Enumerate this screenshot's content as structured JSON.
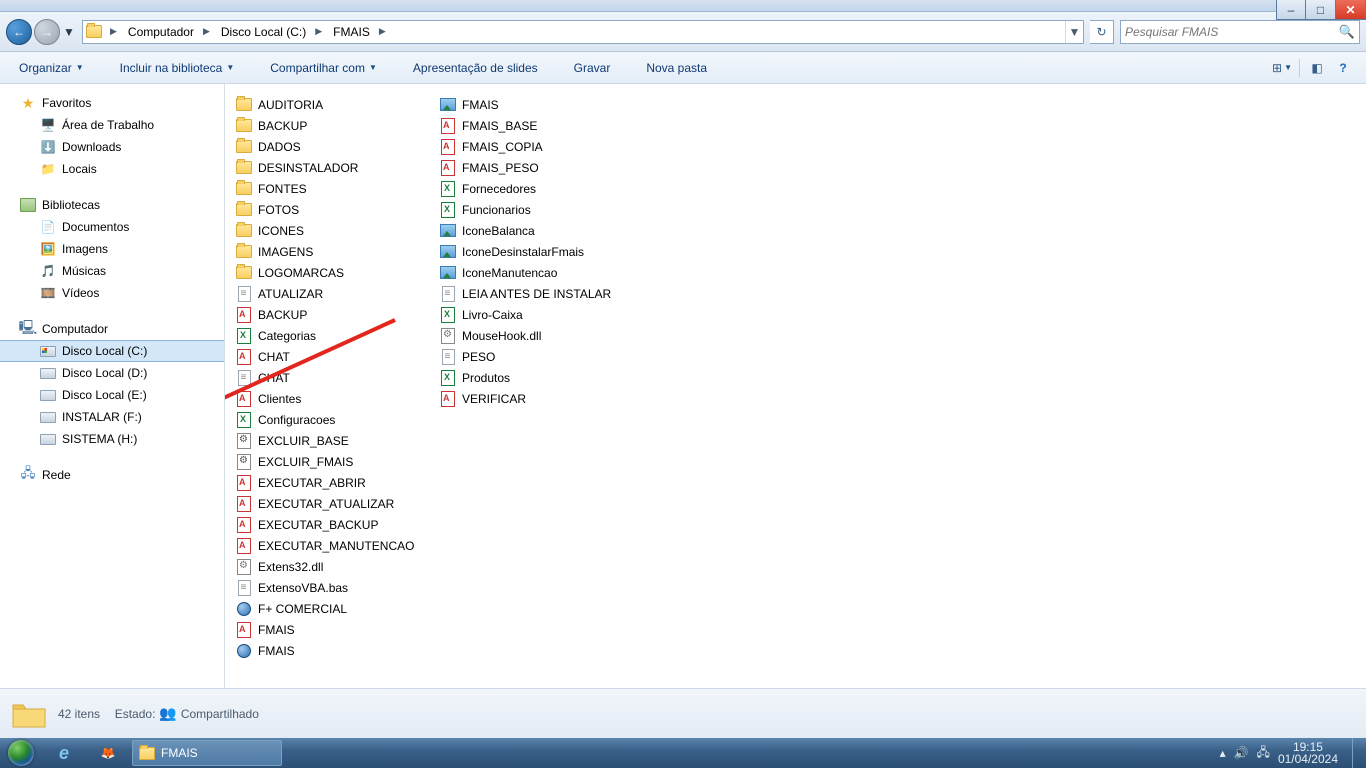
{
  "breadcrumb": {
    "seg1": "Computador",
    "seg2": "Disco Local (C:)",
    "seg3": "FMAIS"
  },
  "search": {
    "placeholder": "Pesquisar FMAIS"
  },
  "toolbar": {
    "organize": "Organizar",
    "include": "Incluir na biblioteca",
    "share": "Compartilhar com",
    "slideshow": "Apresentação de slides",
    "burn": "Gravar",
    "newfolder": "Nova pasta"
  },
  "sidebar": {
    "favorites": "Favoritos",
    "fav": {
      "desktop": "Área de Trabalho",
      "downloads": "Downloads",
      "places": "Locais"
    },
    "libraries": "Bibliotecas",
    "lib": {
      "docs": "Documentos",
      "images": "Imagens",
      "music": "Músicas",
      "videos": "Vídeos"
    },
    "computer": "Computador",
    "drv": {
      "c": "Disco Local (C:)",
      "d": "Disco Local (D:)",
      "e": "Disco Local (E:)",
      "f": "INSTALAR (F:)",
      "h": "SISTEMA (H:)"
    },
    "network": "Rede"
  },
  "files_col1": [
    {
      "t": "folder",
      "n": "AUDITORIA"
    },
    {
      "t": "folder",
      "n": "BACKUP"
    },
    {
      "t": "folder",
      "n": "DADOS"
    },
    {
      "t": "folder",
      "n": "DESINSTALADOR"
    },
    {
      "t": "folder",
      "n": "FONTES"
    },
    {
      "t": "folder",
      "n": "FOTOS"
    },
    {
      "t": "folder",
      "n": "ICONES"
    },
    {
      "t": "folder",
      "n": "IMAGENS"
    },
    {
      "t": "folder",
      "n": "LOGOMARCAS"
    },
    {
      "t": "txt",
      "n": "ATUALIZAR"
    },
    {
      "t": "access",
      "n": "BACKUP"
    },
    {
      "t": "excel",
      "n": "Categorias"
    },
    {
      "t": "access",
      "n": "CHAT"
    },
    {
      "t": "txt",
      "n": "CHAT"
    },
    {
      "t": "access",
      "n": "Clientes"
    },
    {
      "t": "excel",
      "n": "Configuracoes"
    },
    {
      "t": "bat",
      "n": "EXCLUIR_BASE"
    },
    {
      "t": "bat",
      "n": "EXCLUIR_FMAIS"
    },
    {
      "t": "access",
      "n": "EXECUTAR_ABRIR"
    },
    {
      "t": "access",
      "n": "EXECUTAR_ATUALIZAR"
    },
    {
      "t": "access",
      "n": "EXECUTAR_BACKUP"
    },
    {
      "t": "access",
      "n": "EXECUTAR_MANUTENCAO"
    },
    {
      "t": "dll",
      "n": "Extens32.dll"
    },
    {
      "t": "txt",
      "n": "ExtensoVBA.bas"
    },
    {
      "t": "exe",
      "n": "F+ COMERCIAL"
    },
    {
      "t": "access",
      "n": "FMAIS"
    },
    {
      "t": "exe",
      "n": "FMAIS"
    }
  ],
  "files_col2": [
    {
      "t": "img",
      "n": "FMAIS"
    },
    {
      "t": "access",
      "n": "FMAIS_BASE"
    },
    {
      "t": "access",
      "n": "FMAIS_COPIA"
    },
    {
      "t": "access",
      "n": "FMAIS_PESO"
    },
    {
      "t": "excel",
      "n": "Fornecedores"
    },
    {
      "t": "excel",
      "n": "Funcionarios"
    },
    {
      "t": "img",
      "n": "IconeBalanca"
    },
    {
      "t": "img",
      "n": "IconeDesinstalarFmais"
    },
    {
      "t": "img",
      "n": "IconeManutencao"
    },
    {
      "t": "txt",
      "n": "LEIA ANTES DE INSTALAR"
    },
    {
      "t": "excel",
      "n": "Livro-Caixa"
    },
    {
      "t": "dll",
      "n": "MouseHook.dll"
    },
    {
      "t": "txt",
      "n": "PESO"
    },
    {
      "t": "excel",
      "n": "Produtos"
    },
    {
      "t": "access",
      "n": "VERIFICAR"
    }
  ],
  "status": {
    "items": "42 itens",
    "state_label": "Estado:",
    "state_value": "Compartilhado"
  },
  "taskbar": {
    "active": "FMAIS"
  },
  "clock": {
    "time": "19:15",
    "date": "01/04/2024"
  }
}
